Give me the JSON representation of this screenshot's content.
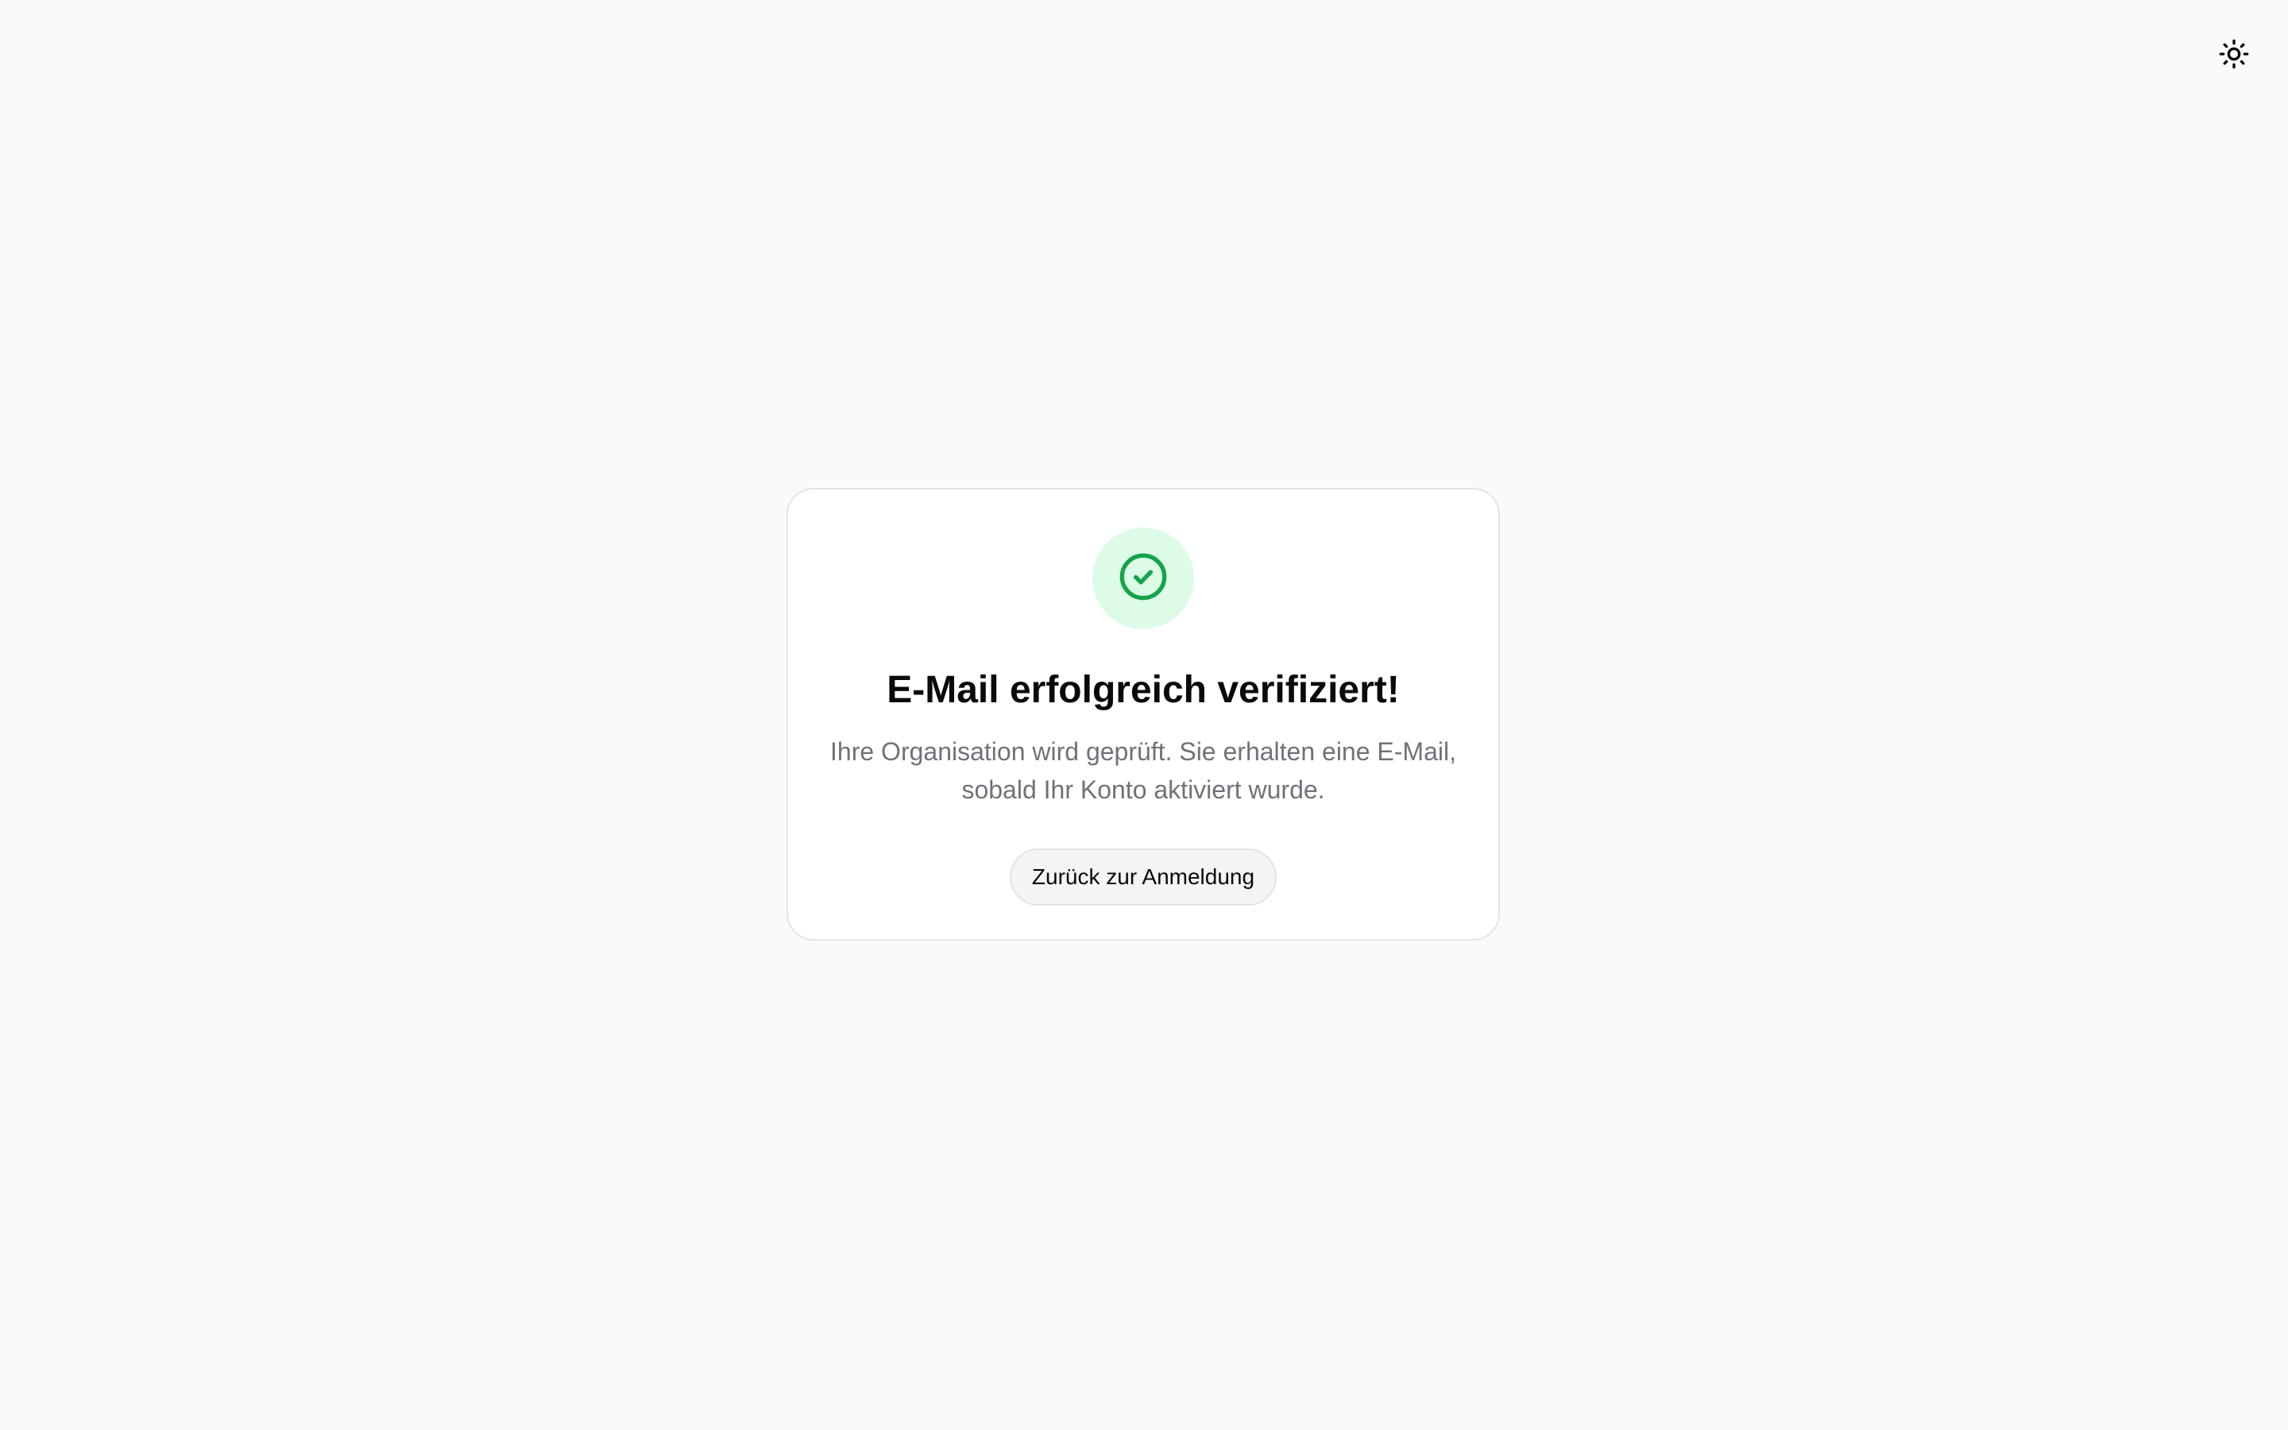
{
  "theme_toggle": {
    "icon": "sun-icon"
  },
  "card": {
    "status_icon": "check-circle-icon",
    "title": "E-Mail erfolgreich verifiziert!",
    "description": "Ihre Organisation wird geprüft. Sie erhalten eine E-Mail, sobald Ihr Konto aktiviert wurde.",
    "button_label": "Zurück zur Anmeldung"
  },
  "colors": {
    "background": "#fafafa",
    "card_background": "#ffffff",
    "success_green": "#16a34a",
    "success_circle_bg": "#dcfce7",
    "text_muted": "#71717a",
    "border": "#e4e4e7"
  }
}
